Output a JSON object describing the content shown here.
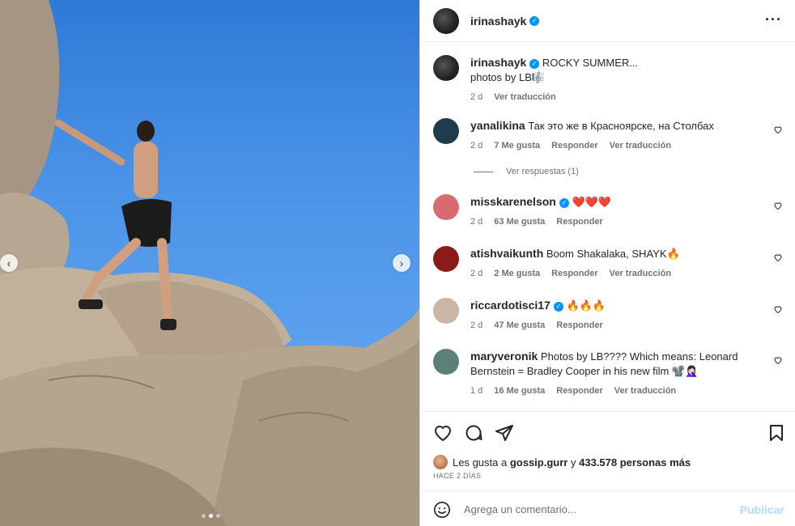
{
  "post": {
    "username": "irinashayk",
    "caption": "ROCKY SUMMER...",
    "caption_line2": "photos by LB🎼",
    "time_ago": "2 d",
    "translate": "Ver traducción"
  },
  "comments": [
    {
      "user": "yanalikina",
      "verified": false,
      "text": "Так это же в Красноярске, на Столбах",
      "age": "2 d",
      "likes": "7 Me gusta",
      "reply": "Responder",
      "translate": "Ver traducción",
      "avatar_color": "#1f3b4d"
    },
    {
      "user": "misskarenelson",
      "verified": true,
      "text": "❤️❤️❤️",
      "age": "2 d",
      "likes": "63 Me gusta",
      "reply": "Responder",
      "translate": "",
      "avatar_color": "#d86b72"
    },
    {
      "user": "atishvaikunth",
      "verified": false,
      "text": "Boom Shakalaka, SHAYK🔥",
      "age": "2 d",
      "likes": "2 Me gusta",
      "reply": "Responder",
      "translate": "Ver traducción",
      "avatar_color": "#8a1b1b"
    },
    {
      "user": "riccardotisci17",
      "verified": true,
      "text": "🔥🔥🔥",
      "age": "2 d",
      "likes": "47 Me gusta",
      "reply": "Responder",
      "translate": "",
      "avatar_color": "#c9b6a6"
    },
    {
      "user": "maryveronik",
      "verified": false,
      "text": "Photos by LB???? Which means: Leonard Bernstein = Bradley Cooper in his new film 📽️🤦🏻‍♀️",
      "age": "1 d",
      "likes": "16 Me gusta",
      "reply": "Responder",
      "translate": "Ver traducción",
      "avatar_color": "#5d7f7a"
    }
  ],
  "view_replies": "Ver respuestas (1)",
  "likes": {
    "prefix": "Les gusta a",
    "user": "gossip.gurr",
    "mid": "y",
    "count": "433.578 personas más"
  },
  "timestamp": "HACE 2 DÍAS",
  "composer": {
    "placeholder": "Agrega un comentario...",
    "post_label": "Publicar"
  },
  "icons": [
    "more-icon",
    "heart-icon",
    "comment-icon",
    "share-icon",
    "bookmark-icon",
    "emoji-icon",
    "chevron-left-icon",
    "chevron-right-icon",
    "verified-icon"
  ],
  "colors": {
    "verified": "#0095f6",
    "link_disabled": "#b3dbff",
    "sky": "#4b93e8"
  }
}
